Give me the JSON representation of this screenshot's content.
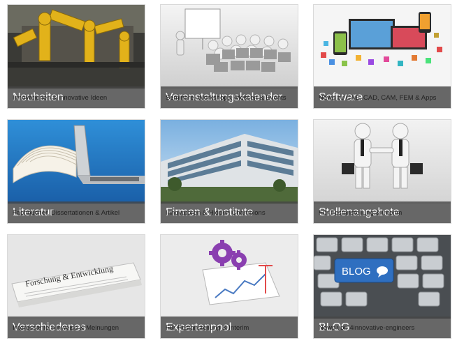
{
  "cards": [
    {
      "title": "Neuheiten",
      "caption": "Innovationen & innovative Ideen",
      "image": "industrial-robots"
    },
    {
      "title": "Veranstaltungskalender",
      "caption": "Seminare, Workshops, Messen & Events",
      "image": "presentation-audience"
    },
    {
      "title": "Software",
      "caption": "News zu CAE, CAD, CAM, FEM & Apps",
      "image": "devices-apps"
    },
    {
      "title": "Literatur",
      "caption": "Fachbücher, Dissertationen & Artikel",
      "image": "book-laptop"
    },
    {
      "title": "Firmen & Institute",
      "caption": "Innovatoren & Hidden Champions",
      "image": "office-building"
    },
    {
      "title": "Stellenangebote",
      "caption": "Für Festanstellung & Interim",
      "image": "handshake"
    },
    {
      "title": "Verschiedenes",
      "caption": "Interessante Hinweise & Meinungen",
      "image": "newspaper",
      "image_text": "Forschung & Entwicklung"
    },
    {
      "title": "Expertenpool",
      "caption": "Für Festanstellung & Interim",
      "image": "gears-chart"
    },
    {
      "title": "BLOG",
      "caption": "News von 4innovative-engineers",
      "image": "blog-keyboard",
      "image_text": "BLOG"
    }
  ],
  "colors": {
    "title_bar": "#464646",
    "blog_key": "#2f6fc0"
  }
}
